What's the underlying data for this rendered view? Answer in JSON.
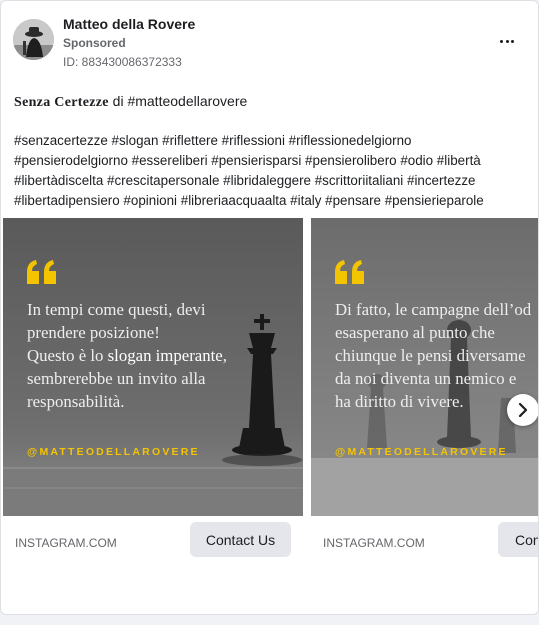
{
  "page": {
    "name": "Matteo della Rovere",
    "sponsored_label": "Sponsored",
    "ad_id": "ID: 883430086372333",
    "more_icon": "more-horizontal-icon"
  },
  "post": {
    "headline_bold": "Senza Certezze",
    "headline_rest": " di #matteodellarovere",
    "hashtags": "#senzacertezze #slogan #riflettere #riflessioni #riflessionedelgiorno #pensierodelgiorno #essereliberi #pensierisparsi #pensierolibero #odio #libertà #libertàdiscelta #crescitapersonale #libridaleggere #scrittoriitaliani #incertezze #libertadipensiero #opinioni #libreriaacquaalta #italy #pensare #pensierieparole"
  },
  "carousel": {
    "accent_color": "#f4c400",
    "next_icon": "chevron-right-icon",
    "cards": [
      {
        "quote_lines": [
          "In tempi come questi, devi",
          "prendere posizione!",
          "Questo è lo ",
          "slogan imperante",
          ",",
          "sembrerebbe un invito alla",
          "responsabilità."
        ],
        "handle": "@MATTEODELLAROVERE",
        "domain": "INSTAGRAM.COM",
        "cta": "Contact Us"
      },
      {
        "quote_lines": [
          "Di fatto, le campagne dell’od",
          "esasperano al punto che",
          "chiunque le pensi diversame",
          "da noi diventa un nemico e",
          "ha diritto di vivere."
        ],
        "handle": "@MATTEODELLAROVERE",
        "domain": "INSTAGRAM.COM",
        "cta": "Cont"
      }
    ]
  }
}
